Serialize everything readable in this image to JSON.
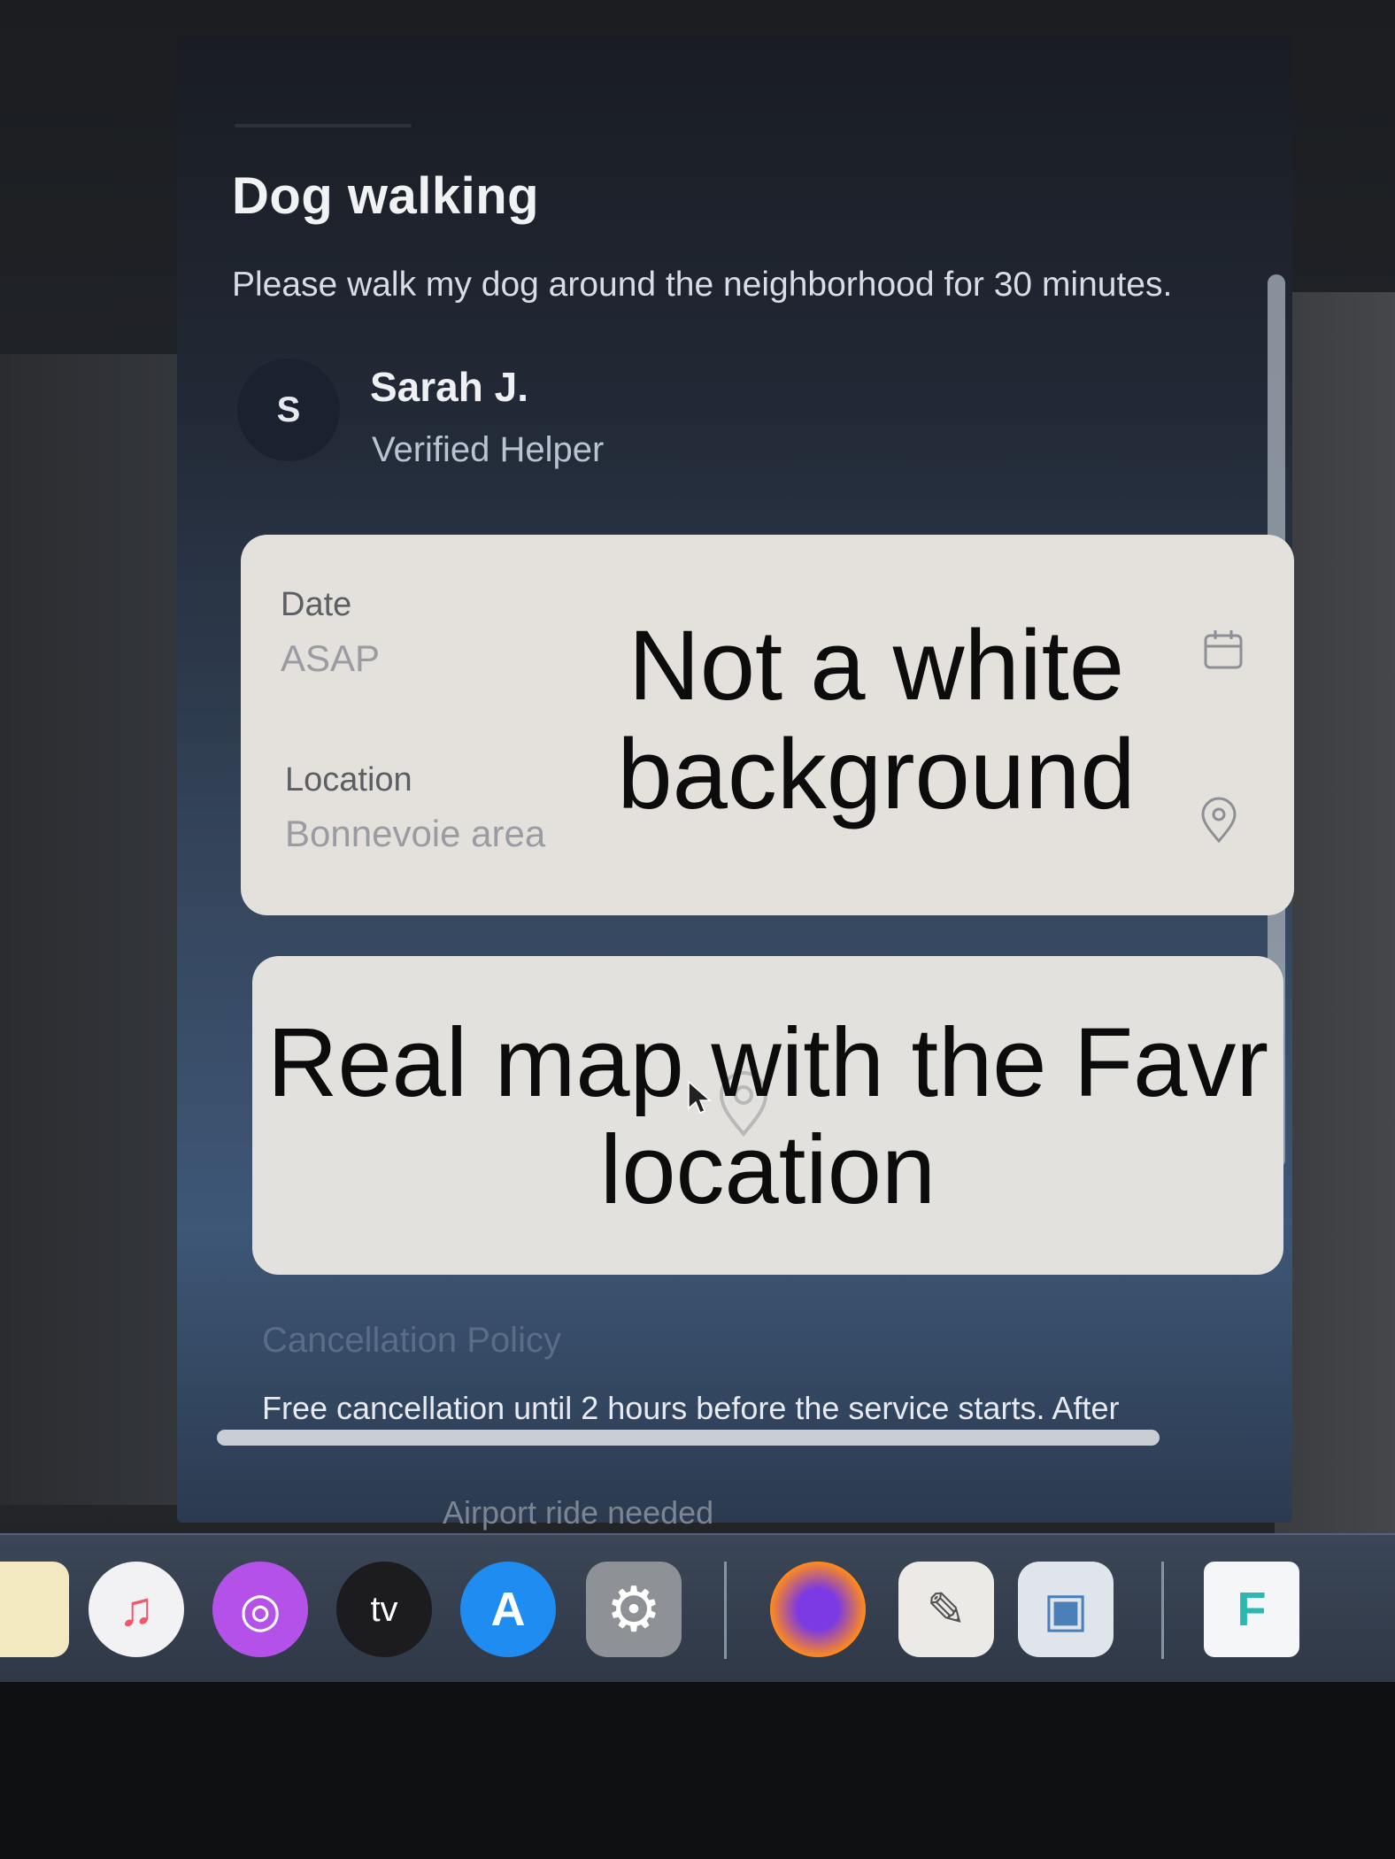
{
  "dialog": {
    "title": "Dog walking",
    "description": "Please walk my dog around the neighborhood for 30 minutes."
  },
  "helper": {
    "initial": "S",
    "name": "Sarah J.",
    "badge": "Verified Helper"
  },
  "details": {
    "date_label": "Date",
    "date_value": "ASAP",
    "location_label": "Location",
    "location_value": "Bonnevoie area",
    "calendar_icon": "calendar-icon",
    "location_icon": "map-pin-icon"
  },
  "annotations": {
    "details_note": "Not a white background",
    "map_note": "Real map with the Favr location"
  },
  "policy": {
    "title": "Cancellation Policy",
    "text": "Free cancellation until 2 hours before the service starts. After"
  },
  "next_item": "Airport ride needed",
  "dock": {
    "apps": [
      {
        "name": "Notes",
        "icon": "notes-icon"
      },
      {
        "name": "Music",
        "icon": "music-icon",
        "glyph": "♫"
      },
      {
        "name": "Podcasts",
        "icon": "podcasts-icon",
        "glyph": "◎"
      },
      {
        "name": "TV",
        "icon": "tv-icon",
        "glyph": "tv"
      },
      {
        "name": "App Store",
        "icon": "app-store-icon",
        "glyph": "A"
      },
      {
        "name": "System Settings",
        "icon": "settings-icon",
        "glyph": "⚙"
      },
      {
        "name": "Firefox",
        "icon": "firefox-icon",
        "glyph": "●"
      },
      {
        "name": "TextEdit",
        "icon": "textedit-icon",
        "glyph": "✎"
      },
      {
        "name": "Preview",
        "icon": "preview-icon",
        "glyph": "▣"
      },
      {
        "name": "Favr",
        "icon": "favr-icon",
        "glyph": "F"
      }
    ]
  },
  "colors": {
    "card_bg": "#e4e1dc",
    "dialog_top": "#191c22",
    "dialog_bottom": "#3e5777",
    "dock_bg": "#3b4656"
  }
}
